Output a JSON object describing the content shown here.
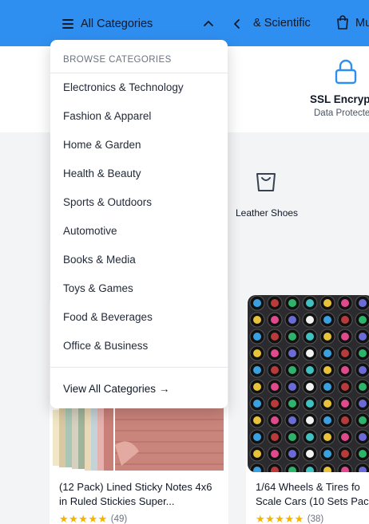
{
  "nav": {
    "all_categories": "All Categories",
    "cat_scientific": "& Scientific",
    "cat_mu": "Mu"
  },
  "trust": {
    "ssl_title": "SSL Encrypt",
    "ssl_sub": "Data Protecte"
  },
  "shortcut": {
    "label": "Leather Shoes"
  },
  "dropdown": {
    "heading": "BROWSE CATEGORIES",
    "items": [
      "Electronics & Technology",
      "Fashion & Apparel",
      "Home & Garden",
      "Health & Beauty",
      "Sports & Outdoors",
      "Automotive",
      "Books & Media",
      "Toys & Games",
      "Food & Beverages",
      "Office & Business"
    ],
    "footer": "View All Categories →"
  },
  "products": [
    {
      "title": "(12 Pack) Lined Sticky Notes 4x6 in Ruled Stickies Super...",
      "stars": "★★★★★",
      "reviews": "(49)"
    },
    {
      "title_line1": "1/64 Wheels & Tires fo",
      "title_line2": "Scale Cars (10 Sets Pac",
      "stars": "★★★★★",
      "reviews": "(38)"
    }
  ],
  "colors": {
    "nav_bg": "#2f8ff0",
    "accent": "#2f8ff0",
    "star": "#f5b301"
  }
}
